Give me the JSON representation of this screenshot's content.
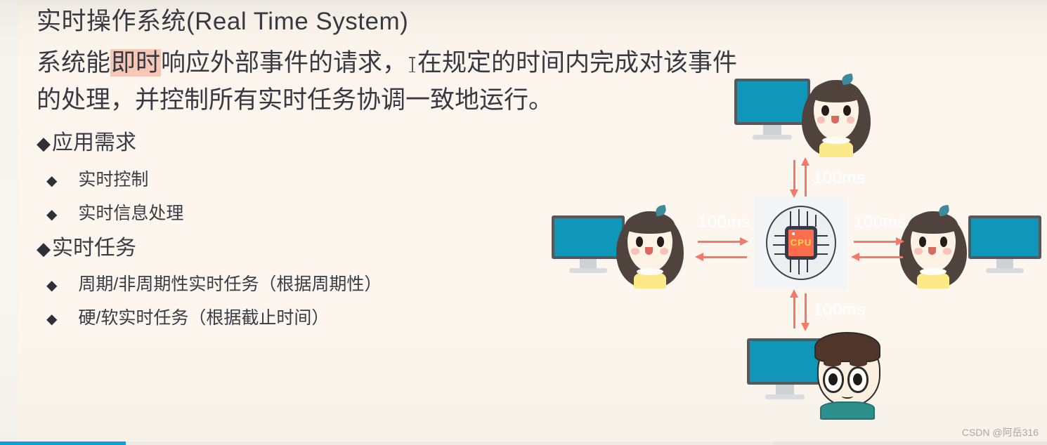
{
  "slide": {
    "title": "实时操作系统(Real Time System)",
    "paragraph": {
      "line1_pre": "系统能",
      "line1_highlight": "即时",
      "line1_mid": "响应外部事件的请求，",
      "line1_post": "在规定的时间内完成对该事件",
      "line2": "的处理，并控制所有实时任务协调一致地运行。"
    },
    "sections": [
      {
        "bullet": "◆",
        "heading": "应用需求",
        "items": [
          {
            "bullet": "◆",
            "label": "实时控制"
          },
          {
            "bullet": "◆",
            "label": "实时信息处理"
          }
        ]
      },
      {
        "bullet": "◆",
        "heading": "实时任务",
        "items": [
          {
            "bullet": "◆",
            "label": "周期/非周期性实时任务（根据周期性）"
          },
          {
            "bullet": "◆",
            "label": "硬/软实时任务（根据截止时间）"
          }
        ]
      }
    ]
  },
  "figure": {
    "cpu_label": "CPU",
    "latency_top": "100ms",
    "latency_left": "100ms",
    "latency_right": "100ms",
    "latency_bottom": "100ms",
    "nodes": [
      {
        "position": "top",
        "avatar": "girl",
        "device": "monitor"
      },
      {
        "position": "left",
        "avatar": "girl",
        "device": "monitor"
      },
      {
        "position": "right",
        "avatar": "girl",
        "device": "monitor"
      },
      {
        "position": "bottom",
        "avatar": "boy",
        "device": "monitor"
      }
    ]
  },
  "watermark": "CSDN @阿岳316",
  "player": {
    "progress_percent": 12
  },
  "colors": {
    "background": "#fbf5ed",
    "text": "#393944",
    "highlight": "#f6c7b4",
    "arrow": "#f4796b",
    "screen": "#0f96b8",
    "cpu_chip": "#fb6d4c",
    "cpu_label": "#ffd84d",
    "progress": "#0aa0dc"
  }
}
